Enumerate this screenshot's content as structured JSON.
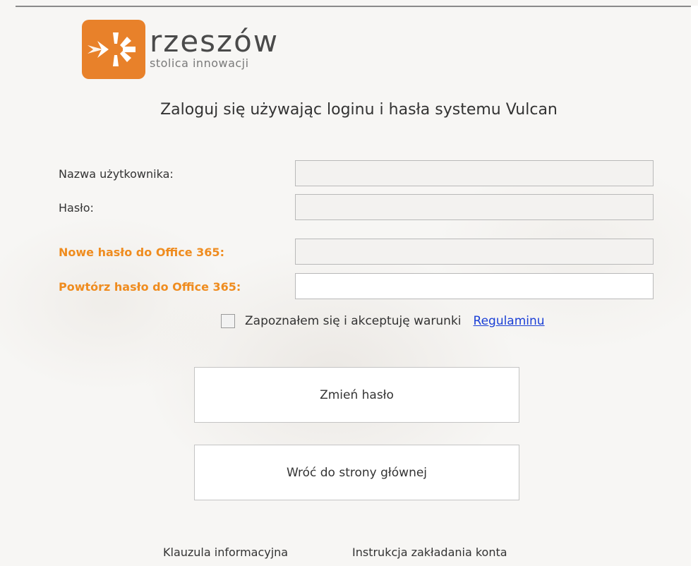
{
  "brand": {
    "name": "rzeszów",
    "tagline": "stolica innowacji",
    "accent_color": "#e8812a"
  },
  "title": "Zaloguj się używając loginu i hasła systemu Vulcan",
  "form": {
    "username_label": "Nazwa użytkownika:",
    "username_value": "",
    "password_label": "Hasło:",
    "password_value": "",
    "new_password_label": "Nowe hasło do Office 365:",
    "new_password_value": "",
    "repeat_password_label": "Powtórz hasło do Office 365:",
    "repeat_password_value": "",
    "label_accent_color": "#ef8c1f"
  },
  "consent": {
    "checked": false,
    "text": "Zapoznałem się i akceptuję warunki",
    "link_text": "Regulaminu"
  },
  "buttons": {
    "change_password": "Zmień hasło",
    "back_home": "Wróć do strony głównej"
  },
  "footer": {
    "info_clause": "Klauzula informacyjna",
    "account_instructions": "Instrukcja zakładania konta"
  }
}
